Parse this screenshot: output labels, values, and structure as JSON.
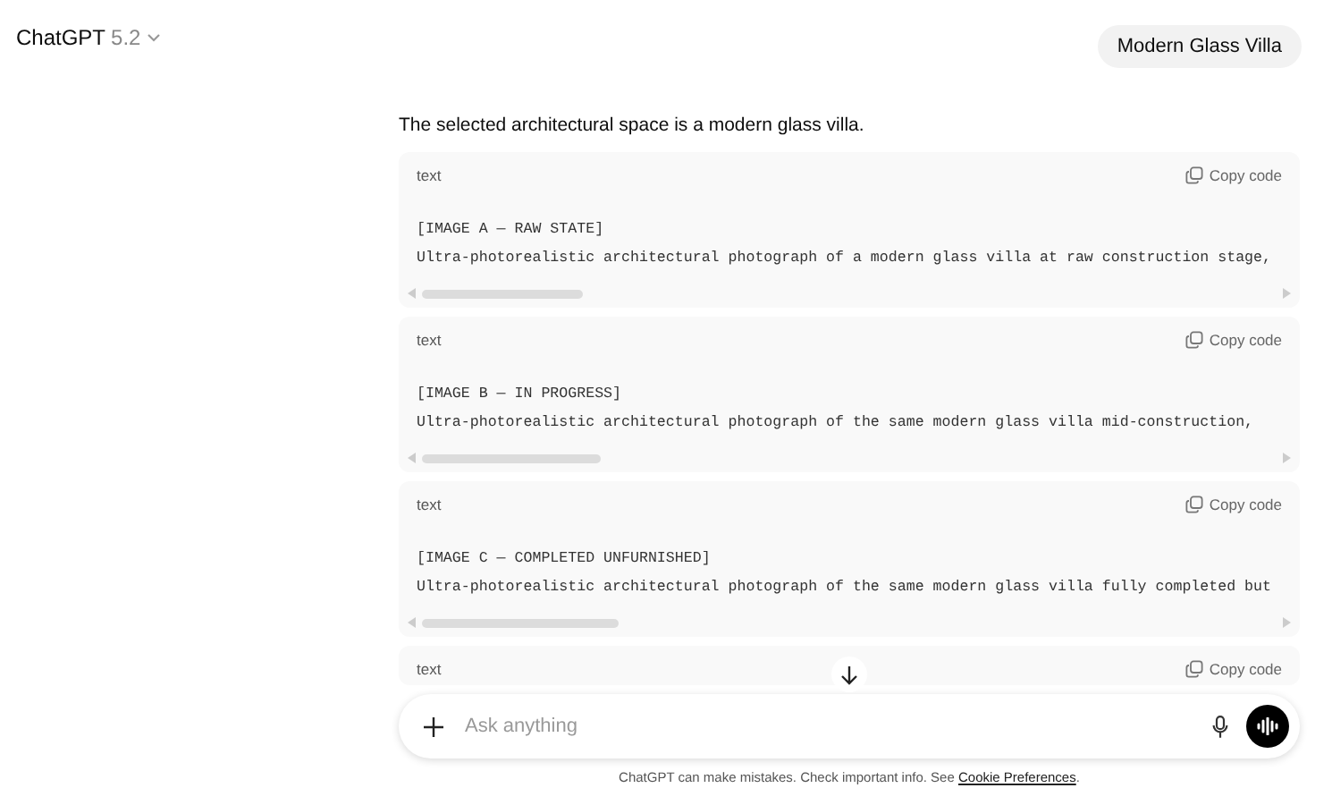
{
  "header": {
    "model": "ChatGPT",
    "version": "5.2",
    "chat_title": "Modern Glass Villa"
  },
  "message": "The selected architectural space is a modern glass villa.",
  "code_blocks": [
    {
      "language": "text",
      "copy_label": "Copy code",
      "lines": [
        "[IMAGE A — RAW STATE]",
        "Ultra-photorealistic architectural photograph of a modern glass villa at raw construction stage,"
      ]
    },
    {
      "language": "text",
      "copy_label": "Copy code",
      "lines": [
        "[IMAGE B — IN PROGRESS]",
        "Ultra-photorealistic architectural photograph of the same modern glass villa mid-construction,"
      ]
    },
    {
      "language": "text",
      "copy_label": "Copy code",
      "lines": [
        "[IMAGE C — COMPLETED UNFURNISHED]",
        "Ultra-photorealistic architectural photograph of the same modern glass villa fully completed but"
      ]
    },
    {
      "language": "text",
      "copy_label": "Copy code"
    }
  ],
  "composer": {
    "placeholder": "Ask anything"
  },
  "footer": {
    "text": "ChatGPT can make mistakes. Check important info. See",
    "link": "Cookie Preferences",
    "end": "."
  }
}
